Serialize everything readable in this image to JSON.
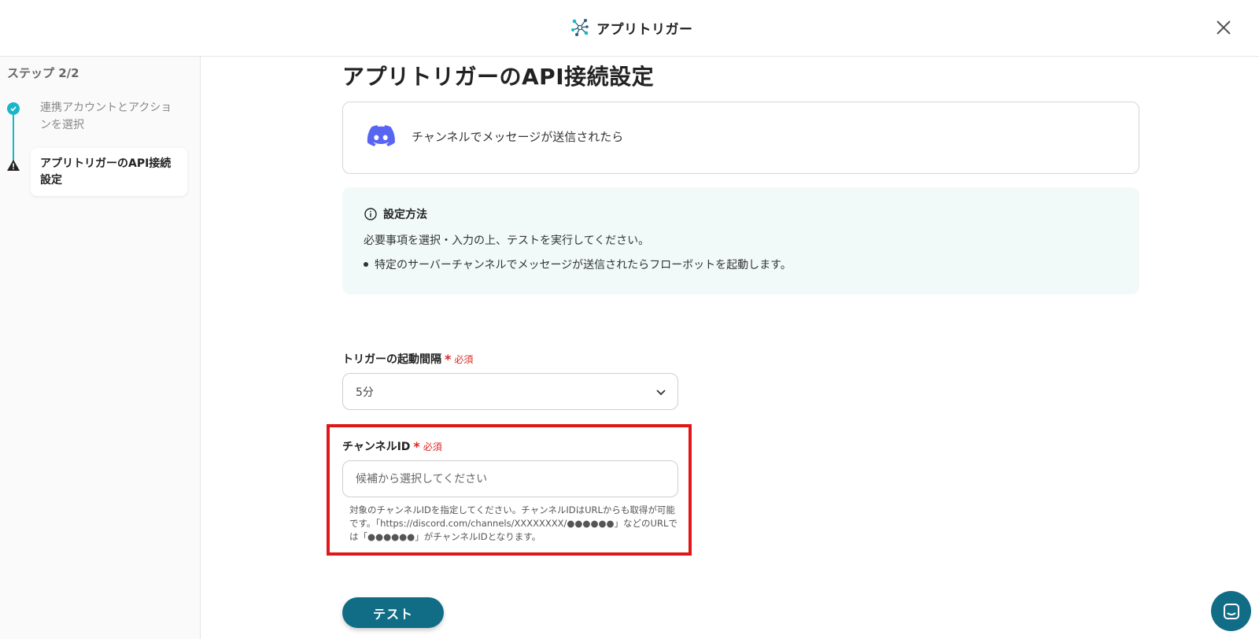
{
  "header": {
    "title": "アプリトリガー",
    "logo_icon": "network-nodes-icon",
    "close_icon": "close-icon"
  },
  "sidebar": {
    "step_label": "ステップ 2/2",
    "steps": [
      {
        "label": "連携アカウントとアクションを選択",
        "status": "complete"
      },
      {
        "label": "アプリトリガーのAPI接続設定",
        "status": "warning"
      }
    ]
  },
  "main": {
    "title": "アプリトリガーのAPI接続設定",
    "app_card": {
      "app_icon": "discord-icon",
      "trigger_label": "チャンネルでメッセージが送信されたら"
    },
    "info": {
      "title": "設定方法",
      "line1": "必要事項を選択・入力の上、テストを実行してください。",
      "bullet1": "特定のサーバーチャンネルでメッセージが送信されたらフローボットを起動します。"
    },
    "interval_field": {
      "label": "トリガーの起動間隔",
      "required_mark": "*",
      "required_text": "必須",
      "value": "5分"
    },
    "channel_field": {
      "label": "チャンネルID",
      "required_mark": "*",
      "required_text": "必須",
      "value": "",
      "placeholder": "候補から選択してください",
      "help": "対象のチャンネルIDを指定してください。チャンネルIDはURLからも取得が可能です。「https://discord.com/channels/XXXXXXXX/●●●●●●」などのURLでは「●●●●●●」がチャンネルIDとなります。"
    },
    "test_button": "テスト"
  },
  "colors": {
    "accent": "#19b5c8",
    "primary_button": "#116d86",
    "required": "#e02424",
    "highlight": "#e0161a",
    "info_bg": "#f1faf8",
    "discord": "#5865f2"
  }
}
